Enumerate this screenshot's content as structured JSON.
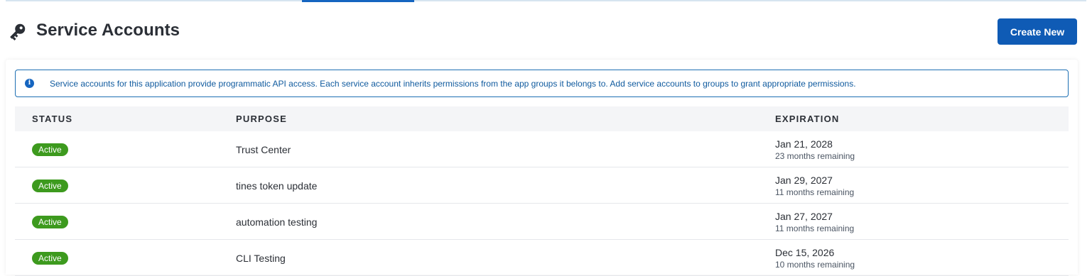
{
  "page": {
    "title": "Service Accounts",
    "icon": "key-icon",
    "accent_color": "#0f5bb5"
  },
  "actions": {
    "create_label": "Create New"
  },
  "info": {
    "icon": "info-icon",
    "text": "Service accounts for this application provide programmatic API access. Each service account inherits permissions from the app groups it belongs to. Add service accounts to groups to grant appropriate permissions."
  },
  "table": {
    "headers": {
      "status": "STATUS",
      "purpose": "PURPOSE",
      "expiration": "EXPIRATION"
    },
    "rows": [
      {
        "status": "Active",
        "purpose": "Trust Center",
        "expiration_date": "Jan 21, 2028",
        "remaining": "23 months remaining"
      },
      {
        "status": "Active",
        "purpose": "tines token update",
        "expiration_date": "Jan 29, 2027",
        "remaining": "11 months remaining"
      },
      {
        "status": "Active",
        "purpose": "automation testing",
        "expiration_date": "Jan 27, 2027",
        "remaining": "11 months remaining"
      },
      {
        "status": "Active",
        "purpose": "CLI Testing",
        "expiration_date": "Dec 15, 2026",
        "remaining": "10 months remaining"
      }
    ],
    "status_color": "#3d9a1e"
  }
}
